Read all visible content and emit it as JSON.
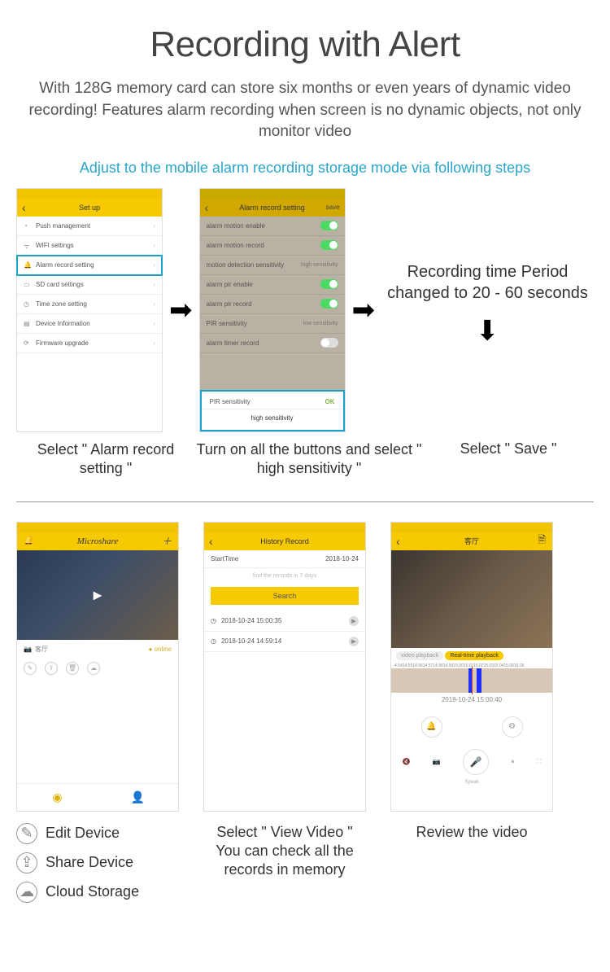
{
  "title": "Recording with Alert",
  "description": "With 128G memory card can store six months or even years of dynamic video recording! Features alarm recording when screen is no dynamic objects, not only monitor video",
  "subhead": "Adjust to the mobile alarm recording storage mode via following steps",
  "step1": {
    "header": "Set up",
    "items": [
      "Push management",
      "WIFI settings",
      "Alarm record setting",
      "SD card settings",
      "Time zone setting",
      "Device Information",
      "Firmware upgrade"
    ],
    "caption": "Select \" Alarm record setting \""
  },
  "step2": {
    "header": "Alarm record setting",
    "save": "save",
    "rows": {
      "r1": "alarm motion enable",
      "r2": "alarm motion record",
      "r3": "motion detection sensitivity",
      "r3v": "high sensitivity",
      "r4": "alarm pir enable",
      "r5": "alarm pir record",
      "r6": "PIR sensitivity",
      "r6v": "low sensitivity",
      "r7": "alarm timer record"
    },
    "sheet": {
      "title": "PIR sensitivity",
      "ok": "OK",
      "opt": "high sensitivity"
    },
    "caption": "Turn on all the buttons and select \" high sensitivity \""
  },
  "step3": {
    "text": "Recording time Period changed to 20 - 60 seconds",
    "caption": "Select \" Save \""
  },
  "bottomA": {
    "brand": "Microshare",
    "device": "客厅",
    "online": "online",
    "legend1": "Edit Device",
    "legend2": "Share Device",
    "legend3": "Cloud Storage"
  },
  "bottomB": {
    "header": "History Record",
    "startLabel": "StartTime",
    "startVal": "2018-10-24",
    "hint": "find the records in 7 days",
    "search": "Search",
    "rec1": "2018-10-24 15:00:35",
    "rec2": "2018-10-24 14:59:14",
    "caption": "Select \" View Video \" You can check all the records in memory"
  },
  "bottomC": {
    "header": "客厅",
    "pill1": "video playback",
    "pill2": "Real-time playback",
    "ticks": "4.5414.5514.5614.5714.5814.5915.0015.0115.0215.0315.0415.0515.06",
    "timestamp": "2018-10-24 15:00:40",
    "speak": "Speak",
    "caption": "Review the video"
  }
}
